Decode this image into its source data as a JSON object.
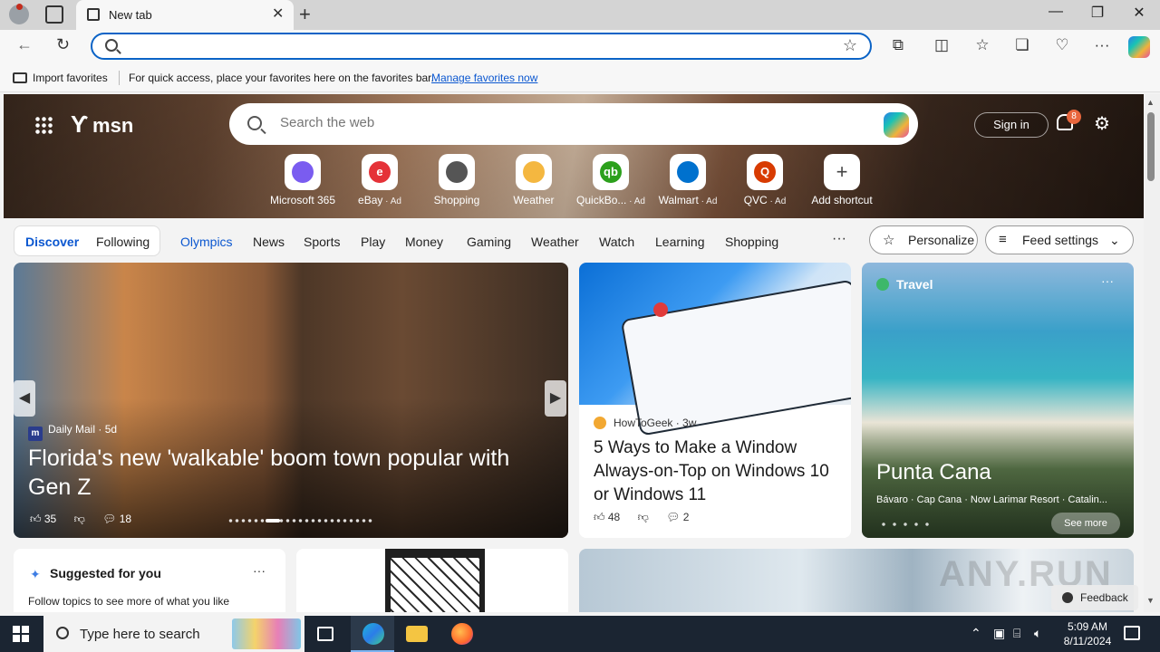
{
  "browser": {
    "tab_title": "New tab",
    "address_placeholder": "",
    "favorites_bar": {
      "import_label": "Import favorites",
      "message": "For quick access, place your favorites here on the favorites bar.",
      "link": "Manage favorites now"
    }
  },
  "msn": {
    "logo_text": "msn",
    "search_placeholder": "Search the web",
    "sign_in": "Sign in",
    "notification_count": "8",
    "shortcuts": [
      {
        "label": "Microsoft 365",
        "ad": "",
        "color": "#7a5cf0",
        "glyph": ""
      },
      {
        "label": "eBay",
        "ad": "· Ad",
        "color": "#e53238",
        "glyph": "e"
      },
      {
        "label": "Shopping",
        "ad": "",
        "color": "#555555",
        "glyph": ""
      },
      {
        "label": "Weather",
        "ad": "",
        "color": "#f4b740",
        "glyph": ""
      },
      {
        "label": "QuickBo...",
        "ad": "· Ad",
        "color": "#2ca01c",
        "glyph": "qb"
      },
      {
        "label": "Walmart",
        "ad": "· Ad",
        "color": "#0071ce",
        "glyph": ""
      },
      {
        "label": "QVC",
        "ad": "· Ad",
        "color": "#d83b01",
        "glyph": "Q"
      },
      {
        "label": "Add shortcut",
        "ad": "",
        "color": "#444444",
        "glyph": "+"
      }
    ],
    "nav": {
      "discover": "Discover",
      "following": "Following",
      "items": [
        "Olympics",
        "News",
        "Sports",
        "Play",
        "Money",
        "Gaming",
        "Weather",
        "Watch",
        "Learning",
        "Shopping"
      ],
      "more": "···",
      "personalize": "Personalize",
      "feed_settings": "Feed settings"
    },
    "hero_card": {
      "source": "Daily Mail",
      "age": "5d",
      "title": "Florida's new 'walkable' boom town popular with Gen Z",
      "likes": "35",
      "comments": "18"
    },
    "article_card": {
      "source": "HowToGeek",
      "age": "3w",
      "title": "5 Ways to Make a Window Always-on-Top on Windows 10 or Windows 11",
      "likes": "48",
      "comments": "2"
    },
    "travel_card": {
      "category": "Travel",
      "title": "Punta Cana",
      "subtitle": "Bávaro · Cap Cana · Now Larimar Resort · Catalin...",
      "see_more": "See more"
    },
    "suggest_card": {
      "title": "Suggested for you",
      "text": "Follow topics to see more of what you like"
    },
    "feedback": "Feedback",
    "watermark": "ANY.RUN"
  },
  "taskbar": {
    "search_placeholder": "Type here to search",
    "time": "5:09 AM",
    "date": "8/11/2024"
  }
}
